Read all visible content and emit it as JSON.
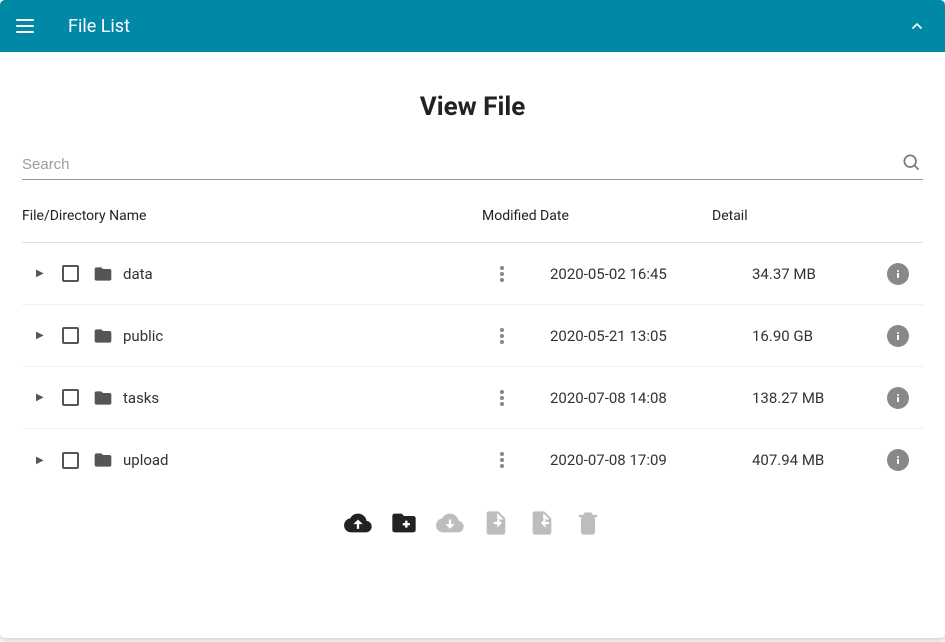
{
  "header": {
    "title": "File List"
  },
  "page": {
    "title": "View File"
  },
  "search": {
    "placeholder": "Search"
  },
  "columns": {
    "name": "File/Directory Name",
    "modified": "Modified Date",
    "detail": "Detail"
  },
  "files": [
    {
      "name": "data",
      "modified": "2020-05-02 16:45",
      "detail": "34.37 MB"
    },
    {
      "name": "public",
      "modified": "2020-05-21 13:05",
      "detail": "16.90 GB"
    },
    {
      "name": "tasks",
      "modified": "2020-07-08 14:08",
      "detail": "138.27 MB"
    },
    {
      "name": "upload",
      "modified": "2020-07-08 17:09",
      "detail": "407.94 MB"
    }
  ],
  "icons": {
    "hamburger": "hamburger-icon",
    "collapse": "chevron-up-icon",
    "search": "search-icon",
    "expand": "chevron-right-icon",
    "folder": "folder-icon",
    "menu": "more-vert-icon",
    "info": "info-icon",
    "upload": "cloud-upload-icon",
    "newfolder": "folder-add-icon",
    "download": "cloud-download-icon",
    "import": "file-import-icon",
    "export": "file-export-icon",
    "delete": "delete-icon"
  }
}
